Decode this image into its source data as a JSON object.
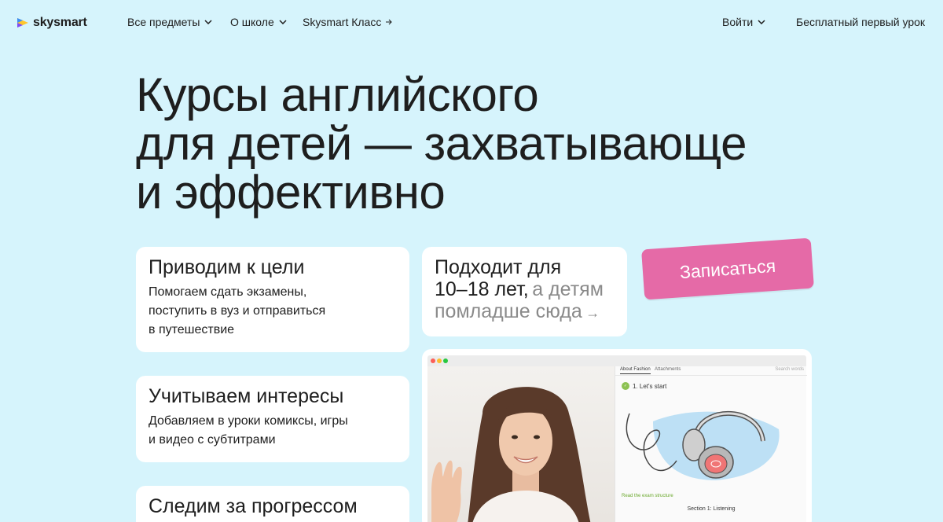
{
  "nav": {
    "logo_text": "skysmart",
    "items": [
      {
        "label": "Все предметы",
        "type": "dropdown"
      },
      {
        "label": "О школе",
        "type": "dropdown"
      },
      {
        "label": "Skysmart Класс",
        "type": "link"
      }
    ],
    "login_label": "Войти",
    "free_lesson_label": "Бесплатный первый урок"
  },
  "hero": {
    "title_lines": [
      "Курсы английского",
      "для детей — захватывающе",
      "и эффективно"
    ]
  },
  "features": [
    {
      "title": "Приводим к цели",
      "text_lines": [
        "Помогаем сдать экзамены,",
        "поступить в вуз и отправиться",
        "в путешествие"
      ]
    },
    {
      "title": "Учитываем интересы",
      "text_lines": [
        "Добавляем в уроки комиксы, игры",
        "и видео с субтитрами"
      ]
    },
    {
      "title": "Следим за прогрессом"
    }
  ],
  "age_card": {
    "line1": "Подходит для",
    "line2_main": "10–18 лет,",
    "line2_link": "а детям",
    "line3_link": "помладше сюда",
    "arrow": "→"
  },
  "cta": {
    "label": "Записаться"
  },
  "preview": {
    "tab_active": "About Fashion",
    "tab_other": "Attachments",
    "search_placeholder": "Search words",
    "step_label": "1. Let's start",
    "green_caption": "Read the exam structure",
    "section_label": "Section 1: Listening"
  },
  "colors": {
    "background": "#d6f4fc",
    "cta": "#e56aa7",
    "card": "#ffffff",
    "muted_link": "#8a8a8a"
  },
  "icons": {
    "logo": "skysmart-play-icon",
    "dropdown": "chevron-down-icon",
    "external": "arrow-right-icon"
  }
}
